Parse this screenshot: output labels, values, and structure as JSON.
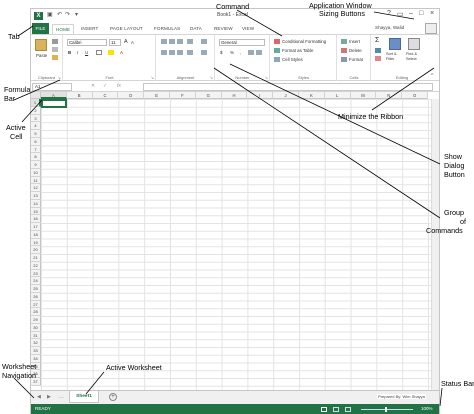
{
  "window": {
    "title": "Book1 - Excel",
    "quick_access": [
      "save-icon",
      "undo-icon",
      "redo-icon"
    ],
    "user_name": "Shayya, Walid",
    "controls": [
      "?",
      "▭",
      "–",
      "□",
      "×"
    ]
  },
  "tabs": [
    "FILE",
    "HOME",
    "INSERT",
    "PAGE LAYOUT",
    "FORMULAS",
    "DATA",
    "REVIEW",
    "VIEW"
  ],
  "active_tab": "HOME",
  "ribbon": {
    "clipboard": {
      "label": "Clipboard",
      "paste": "Paste"
    },
    "font": {
      "label": "Font",
      "name": "Calibri",
      "size": "11",
      "bold": "B",
      "italic": "I",
      "underline": "U",
      "grow": "A",
      "shrink": "A"
    },
    "alignment": {
      "label": "Alignment"
    },
    "number": {
      "label": "Number",
      "format": "General",
      "currency": "$",
      "percent": "%",
      "comma": ","
    },
    "styles": {
      "label": "Styles",
      "conditional": "Conditional Formatting",
      "table": "Format as Table",
      "cell_styles": "Cell Styles"
    },
    "cells": {
      "label": "Cells",
      "insert": "Insert",
      "delete": "Delete",
      "format": "Format"
    },
    "editing": {
      "label": "Editing",
      "sum": "Σ",
      "sort": "Sort & Filter",
      "find": "Find & Select"
    }
  },
  "formula_bar": {
    "name_box": "A1",
    "fx": "fx"
  },
  "columns": [
    "A",
    "B",
    "C",
    "D",
    "E",
    "F",
    "G",
    "H",
    "I",
    "J",
    "K",
    "L",
    "M",
    "N",
    "O"
  ],
  "rows": [
    "1",
    "2",
    "3",
    "4",
    "5",
    "6",
    "7",
    "8",
    "9",
    "10",
    "11",
    "12",
    "13",
    "14",
    "15",
    "16",
    "17",
    "18",
    "19",
    "20",
    "21",
    "22",
    "23",
    "24",
    "25",
    "26",
    "27",
    "28",
    "29",
    "30",
    "31",
    "32",
    "33",
    "34",
    "35",
    "36",
    "37"
  ],
  "sheet": {
    "tab": "Sheet1",
    "add": "+",
    "prepared_by": "Prepared By: Wim Shayya"
  },
  "status": {
    "text": "READY",
    "zoom": "100%"
  },
  "callouts": {
    "tab": "Tab",
    "command": "Command",
    "app_sizing": [
      "Application Window",
      "Sizing Buttons"
    ],
    "formula_bar": [
      "Formula",
      "Bar"
    ],
    "active_cell": [
      "Active",
      "Cell"
    ],
    "minimize_ribbon": "Minimize the Ribbon",
    "show_dialog": [
      "Show",
      "Dialog",
      "Button"
    ],
    "group_commands": [
      "Group",
      "of",
      "Commands"
    ],
    "active_worksheet": "Active Worksheet",
    "worksheet_nav": [
      "Worksheet",
      "Navigation"
    ],
    "status_bar": "Status Bar"
  },
  "colors": {
    "excel_green": "#217346",
    "header_bg": "#f3f3f3",
    "grid_line": "#e3e3e3"
  }
}
